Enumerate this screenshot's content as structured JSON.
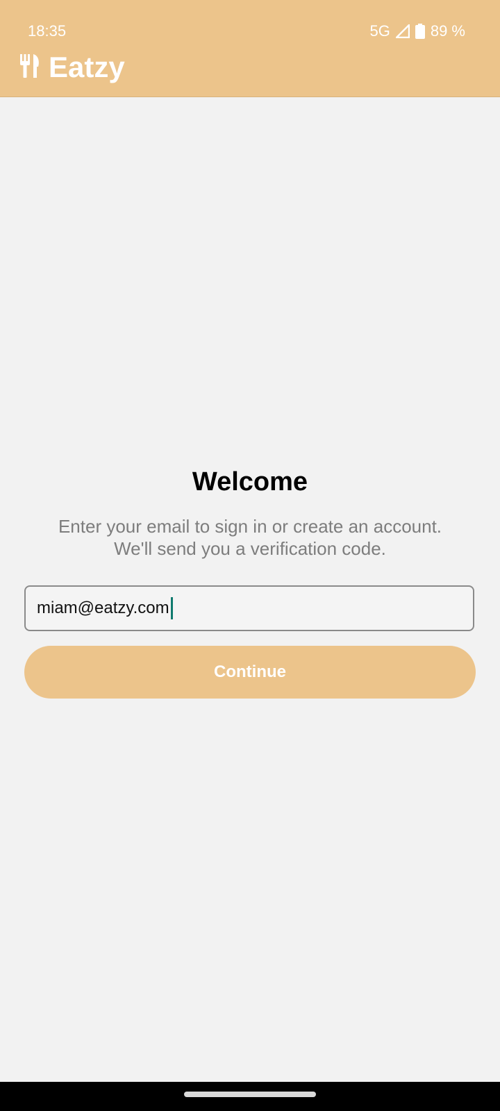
{
  "status_bar": {
    "time": "18:35",
    "network": "5G",
    "battery": "89 %"
  },
  "app": {
    "title": "Eatzy",
    "logo_icon": "fork-knife-icon",
    "accent_color": "#ecc48b"
  },
  "main": {
    "heading": "Welcome",
    "subtitle_line1": "Enter your email to sign in or create an account.",
    "subtitle_line2": "We'll send you a verification code.",
    "email_value": "miam@eatzy.com",
    "continue_label": "Continue"
  }
}
